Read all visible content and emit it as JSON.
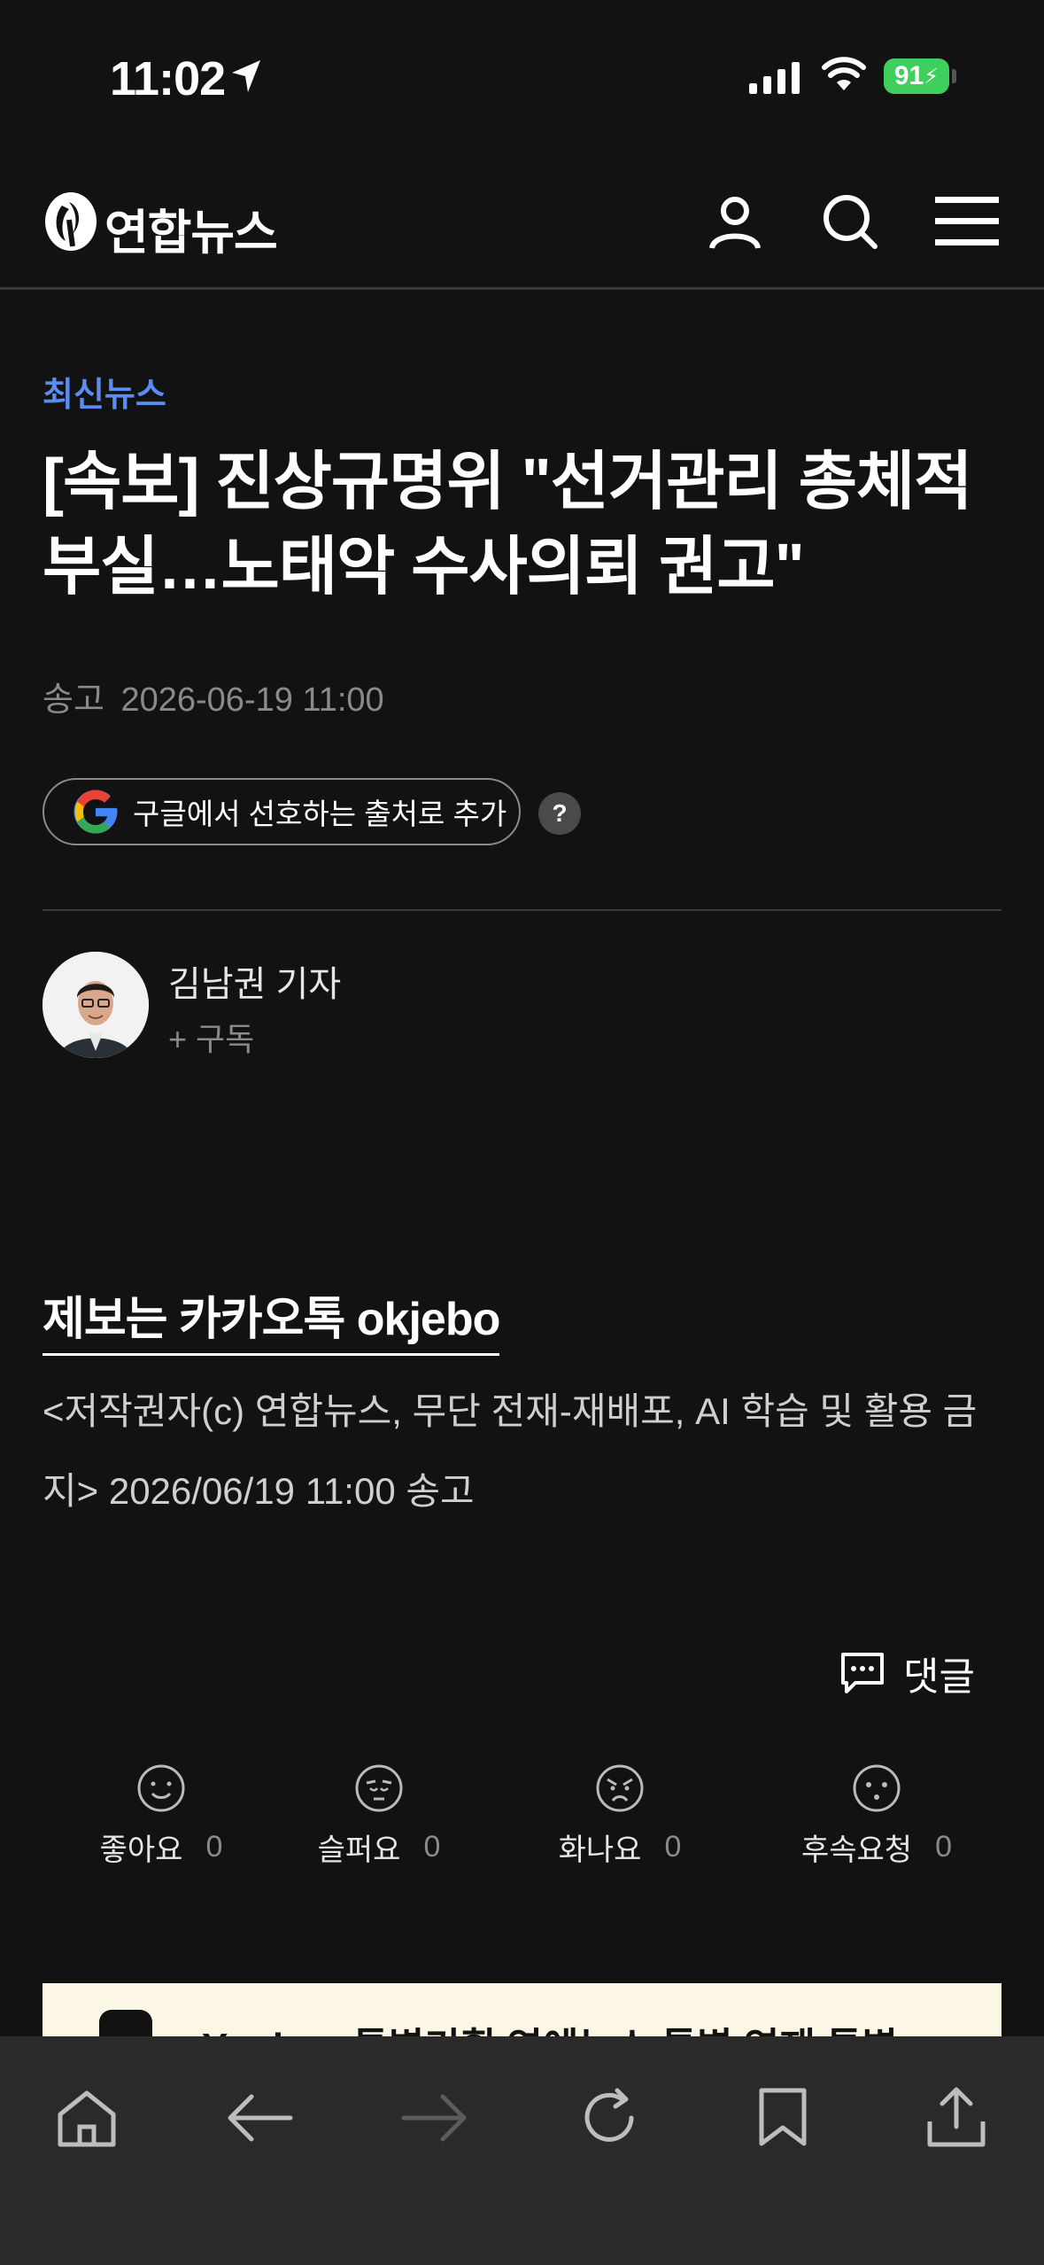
{
  "status_bar": {
    "time": "11:02",
    "battery": "91"
  },
  "header": {
    "logo_text": "연합뉴스",
    "icons": [
      "user-icon",
      "search-icon",
      "menu-icon"
    ]
  },
  "article": {
    "category": "최신뉴스",
    "headline": "[속보] 진상규명위 \"선거관리 총체적 부실…노태악 수사의뢰 권고\"",
    "sent_label": "송고",
    "sent_time": "2026-06-19 11:00",
    "google_button_label": "구글에서 선호하는 출처로 추가",
    "help_label": "?",
    "reporter_name": "김남권 기자",
    "subscribe_label": "+ 구독",
    "tip_link": "제보는 카카오톡 okjebo",
    "copyright": "<저작권자(c) 연합뉴스, 무단 전재-재배포, AI 학습 및 활용 금지> 2026/06/19 11:00 송고",
    "comment_label": "댓글"
  },
  "reactions": [
    {
      "label": "좋아요",
      "count": "0"
    },
    {
      "label": "슬퍼요",
      "count": "0"
    },
    {
      "label": "화나요",
      "count": "0"
    },
    {
      "label": "후속요청",
      "count": "0"
    }
  ],
  "ad_banner": {
    "text": "Yonhap 특별기획 연예뉴스 특별 연재 특별"
  },
  "toolbar": {
    "icons": [
      "home-icon",
      "back-arrow-icon",
      "forward-arrow-icon",
      "reload-icon",
      "bookmark-icon",
      "share-icon"
    ]
  },
  "colors": {
    "background": "#121212",
    "accent": "#5b8def",
    "battery": "#3fcf5d",
    "toolbar": "#2a2a2a"
  }
}
